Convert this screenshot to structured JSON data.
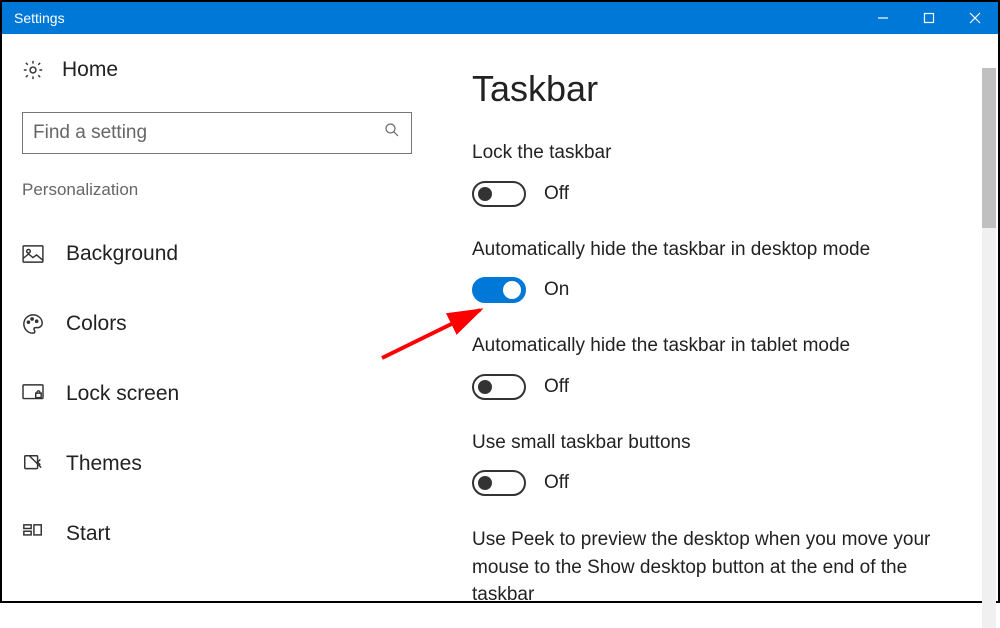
{
  "window": {
    "title": "Settings"
  },
  "sidebar": {
    "home": "Home",
    "search_placeholder": "Find a setting",
    "section": "Personalization",
    "items": [
      {
        "label": "Background"
      },
      {
        "label": "Colors"
      },
      {
        "label": "Lock screen"
      },
      {
        "label": "Themes"
      },
      {
        "label": "Start"
      }
    ]
  },
  "main": {
    "title": "Taskbar",
    "settings": [
      {
        "label": "Lock the taskbar",
        "state": "Off"
      },
      {
        "label": "Automatically hide the taskbar in desktop mode",
        "state": "On"
      },
      {
        "label": "Automatically hide the taskbar in tablet mode",
        "state": "Off"
      },
      {
        "label": "Use small taskbar buttons",
        "state": "Off"
      }
    ],
    "peek_text": "Use Peek to preview the desktop when you move your mouse to the Show desktop button at the end of the taskbar"
  }
}
